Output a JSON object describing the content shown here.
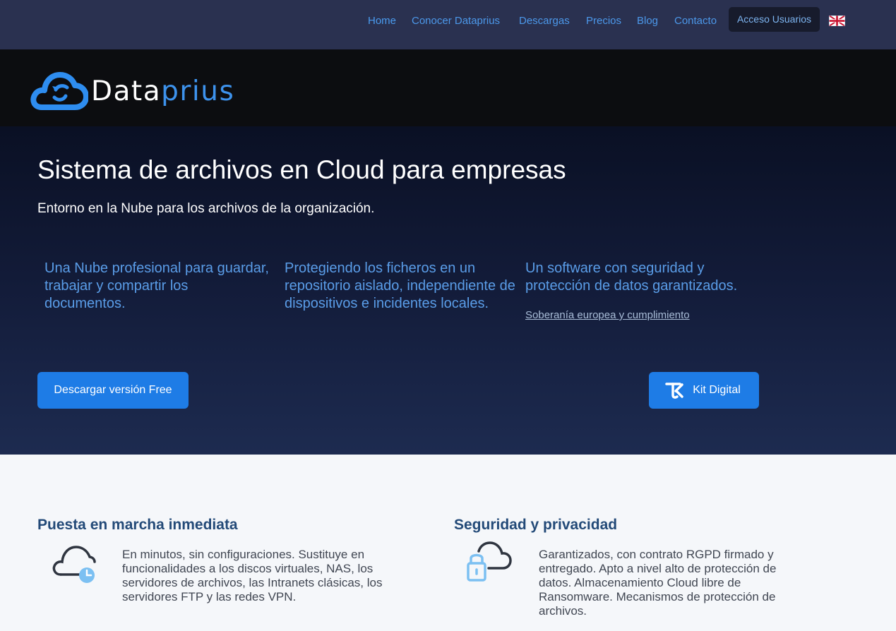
{
  "nav": {
    "items": [
      {
        "label": "Home",
        "color": "#3d92ec"
      },
      {
        "label": "Conocer Dataprius"
      },
      {
        "label": "Descargas"
      },
      {
        "label": "Precios"
      },
      {
        "label": "Blog"
      },
      {
        "label": "Contacto"
      }
    ],
    "access_label": "Acceso Usuarios",
    "language_icon": "uk-flag-icon"
  },
  "logo": {
    "text_part1": "Data",
    "text_part2": "prius",
    "icon": "cloud-refresh-icon"
  },
  "hero": {
    "title": "Sistema de archivos en Cloud para empresas",
    "subtitle": "Entorno en la Nube para los archivos de la organización.",
    "features": [
      "Una Nube profesional para guardar, trabajar y compartir los documentos.",
      "Protegiendo los ficheros en un repositorio aislado, independiente de dispositivos e incidentes locales.",
      "Un software con seguridad y protección de datos garantizados."
    ],
    "sovereignty_link": "Soberanía europea y cumplimiento",
    "download_button": "Descargar versión Free",
    "kit_button": "Kit Digital",
    "kit_icon": "kit-digital-icon"
  },
  "sections": [
    {
      "heading": "Puesta en marcha inmediata",
      "text": "En minutos, sin configuraciones. Sustituye en funcionalidades a los discos virtuales, NAS, los servidores de archivos, las Intranets clásicas, los servidores FTP y las redes VPN.",
      "icon": "cloud-clock-icon"
    },
    {
      "heading": "Seguridad y privacidad",
      "text": "Garantizados, con contrato RGPD firmado y entregado. Apto a nivel alto de protección de datos. Almacenamiento Cloud libre de Ransomware. Mecanismos de protección de archivos.",
      "icon": "cloud-lock-icon"
    }
  ],
  "colors": {
    "accent": "#1e7ce6",
    "nav_bg": "#2a3150",
    "heading_blue": "#234a78"
  }
}
